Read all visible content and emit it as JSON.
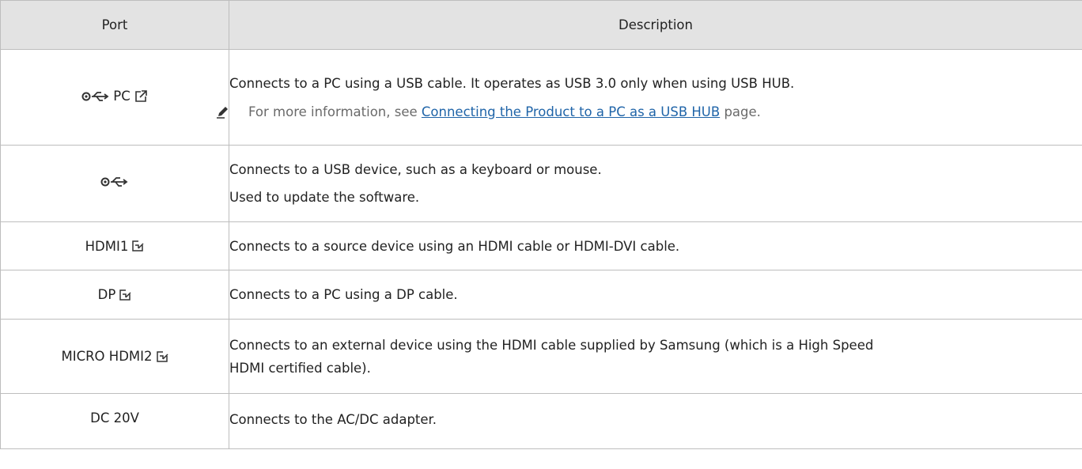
{
  "table": {
    "headers": {
      "port": "Port",
      "description": "Description"
    },
    "rows": [
      {
        "port": "PC",
        "port_icons": [
          "usb-icon",
          "external-link-icon"
        ],
        "desc": [
          "Connects to a PC using a USB cable. It operates as USB 3.0 only when using USB HUB."
        ],
        "note": {
          "icon": "pencil-note-icon",
          "prefix": "For more information, see",
          "link": "Connecting the Product to a PC as a USB HUB",
          "suffix": "page."
        }
      },
      {
        "port": "",
        "port_icons": [
          "usb-icon"
        ],
        "desc": [
          "Connects to a USB device, such as a keyboard or mouse.",
          "Used to update the software."
        ]
      },
      {
        "port": "HDMI1",
        "port_icons": [
          "hdmi-input-icon"
        ],
        "desc": [
          "Connects to a source device using an HDMI cable or HDMI-DVI cable."
        ]
      },
      {
        "port": "DP",
        "port_icons": [
          "hdmi-input-icon"
        ],
        "desc": [
          "Connects to a PC using a DP cable."
        ]
      },
      {
        "port": "MICRO HDMI2",
        "port_icons": [
          "hdmi-input-icon"
        ],
        "desc": [
          "Connects to an external device using the HDMI cable supplied by Samsung (which is a High Speed",
          "HDMI certified cable)."
        ]
      },
      {
        "port": "DC 20V",
        "desc": [
          "Connects to the AC/DC adapter."
        ]
      }
    ]
  }
}
